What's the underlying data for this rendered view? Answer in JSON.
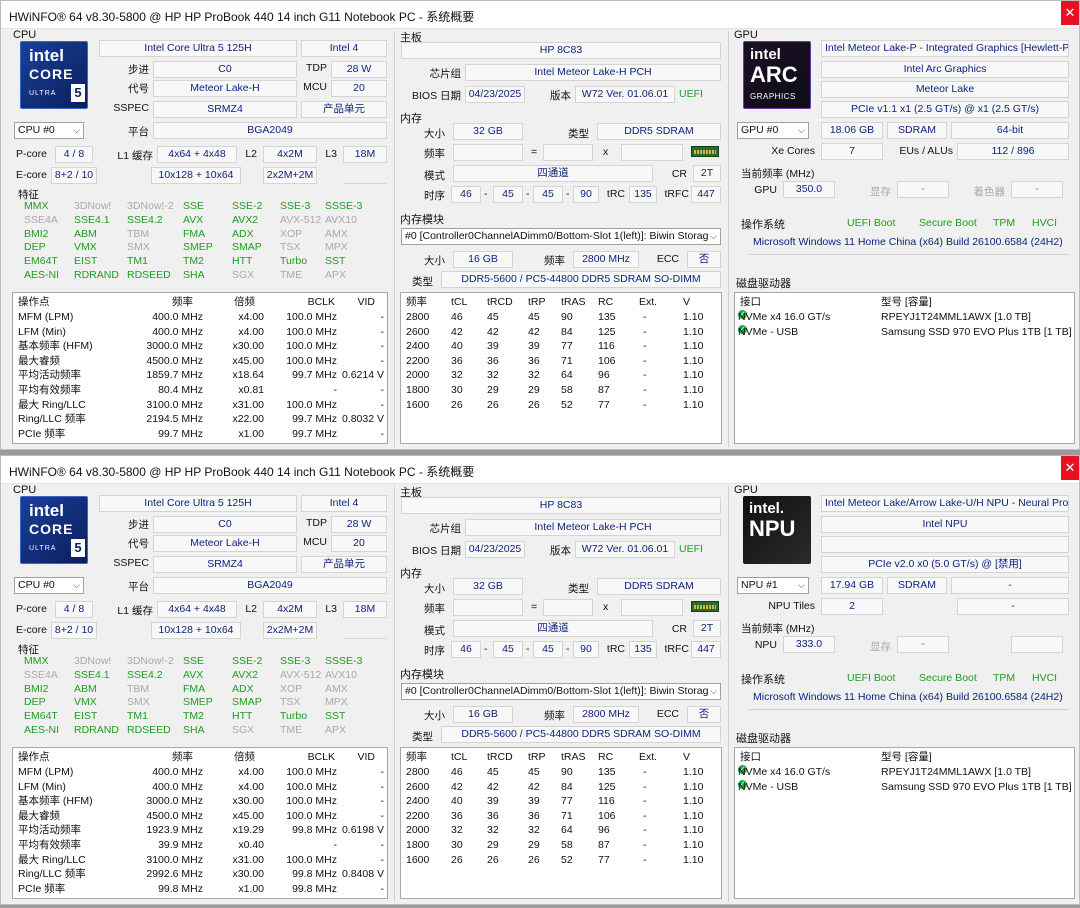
{
  "windows": [
    {
      "title": "HWiNFO® 64 v8.30-5800 @ HP HP ProBook 440 14 inch G11 Notebook PC - 系统概要",
      "close_icon": "✕",
      "cpu": {
        "section": "CPU",
        "name": "Intel Core Ultra 5 125H",
        "gen": "Intel 4",
        "stepping_label": "步进",
        "stepping": "C0",
        "tdp_label": "TDP",
        "tdp": "28 W",
        "codename_label": "代号",
        "codename": "Meteor Lake-H",
        "mcu_label": "MCU",
        "mcu": "20",
        "sspec_label": "SSPEC",
        "sspec": "SRMZ4",
        "produnit": "产品单元",
        "selector": "CPU #0",
        "platform_label": "平台",
        "platform": "BGA2049",
        "pcore_label": "P-core",
        "pcore": "4 / 8",
        "l1_label": "L1 缓存",
        "l1": "4x64 + 4x48",
        "l2_label": "L2",
        "l2": "4x2M",
        "l3_label": "L3",
        "l3": "18M",
        "ecore_label": "E-core",
        "ecore": "8+2 / 10",
        "l1e": "10x128 + 10x64",
        "l2e": "2x2M+2M",
        "features_label": "特征",
        "features": [
          [
            "MMX",
            "3DNow!",
            "3DNow!-2",
            "SSE",
            "SSE-2",
            "SSE-3",
            "SSSE-3"
          ],
          [
            "SSE4A",
            "SSE4.1",
            "SSE4.2",
            "AVX",
            "AVX2",
            "AVX-512",
            "AVX10"
          ],
          [
            "BMI2",
            "ABM",
            "TBM",
            "FMA",
            "ADX",
            "XOP",
            "AMX"
          ],
          [
            "DEP",
            "VMX",
            "SMX",
            "SMEP",
            "SMAP",
            "TSX",
            "MPX"
          ],
          [
            "EM64T",
            "EIST",
            "TM1",
            "TM2",
            "HTT",
            "Turbo",
            "SST"
          ],
          [
            "AES-NI",
            "RDRAND",
            "RDSEED",
            "SHA",
            "SGX",
            "TME",
            "APX"
          ]
        ],
        "features_enabled": [
          [
            1,
            0,
            0,
            1,
            1,
            1,
            1
          ],
          [
            0,
            1,
            1,
            1,
            1,
            0,
            0
          ],
          [
            1,
            1,
            0,
            1,
            1,
            0,
            0
          ],
          [
            1,
            1,
            0,
            1,
            1,
            0,
            0
          ],
          [
            1,
            1,
            1,
            1,
            1,
            1,
            1
          ],
          [
            1,
            1,
            1,
            1,
            0,
            0,
            0
          ]
        ],
        "op_headers": [
          "操作点",
          "频率",
          "倍频",
          "BCLK",
          "VID"
        ],
        "op_rows": [
          [
            "MFM (LPM)",
            "400.0 MHz",
            "x4.00",
            "100.0 MHz",
            "-"
          ],
          [
            "LFM (Min)",
            "400.0 MHz",
            "x4.00",
            "100.0 MHz",
            "-"
          ],
          [
            "基本频率 (HFM)",
            "3000.0 MHz",
            "x30.00",
            "100.0 MHz",
            "-"
          ],
          [
            "最大睿频",
            "4500.0 MHz",
            "x45.00",
            "100.0 MHz",
            "-"
          ],
          [
            "平均活动频率",
            "1859.7 MHz",
            "x18.64",
            "99.7 MHz",
            "0.6214 V"
          ],
          [
            "平均有效频率",
            "80.4 MHz",
            "x0.81",
            "-",
            "-"
          ],
          [
            "最大 Ring/LLC",
            "3100.0 MHz",
            "x31.00",
            "100.0 MHz",
            "-"
          ],
          [
            "Ring/LLC 频率",
            "2194.5 MHz",
            "x22.00",
            "99.7 MHz",
            "0.8032 V"
          ],
          [
            "PCIe 频率",
            "99.7 MHz",
            "x1.00",
            "99.7 MHz",
            "-"
          ]
        ]
      },
      "mb": {
        "section": "主板",
        "name": "HP 8C83",
        "chipset_label": "芯片组",
        "chipset": "Intel Meteor Lake-H PCH",
        "bios_label": "BIOS 日期",
        "bios_date": "04/23/2025",
        "ver_label": "版本",
        "bios_ver": "W72 Ver. 01.06.01",
        "uefi": "UEFI"
      },
      "mem": {
        "section": "内存",
        "size_label": "大小",
        "size": "32 GB",
        "type_label": "类型",
        "type": "DDR5 SDRAM",
        "freq_label": "频率",
        "eq": "=",
        "x": "x",
        "mode_label": "模式",
        "mode": "四通道",
        "cr_label": "CR",
        "cr": "2T",
        "timing_label": "时序",
        "t1": "46",
        "t2": "45",
        "t3": "45",
        "t4": "90",
        "dash": "-",
        "trc_label": "tRC",
        "trc": "135",
        "trfc_label": "tRFC",
        "trfc": "447"
      },
      "modules": {
        "section": "内存模块",
        "selector": "#0 [Controller0ChannelADimm0/Bottom-Slot 1(left)]: Biwin Storag",
        "size_label": "大小",
        "size": "16 GB",
        "freq_label": "频率",
        "freq": "2800 MHz",
        "ecc_label": "ECC",
        "ecc": "否",
        "type_label": "类型",
        "type": "DDR5-5600 / PC5-44800 DDR5 SDRAM SO-DIMM",
        "headers": [
          "频率",
          "tCL",
          "tRCD",
          "tRP",
          "tRAS",
          "RC",
          "Ext.",
          "V"
        ],
        "rows": [
          [
            "2800",
            "46",
            "45",
            "45",
            "90",
            "135",
            "-",
            "1.10"
          ],
          [
            "2600",
            "42",
            "42",
            "42",
            "84",
            "125",
            "-",
            "1.10"
          ],
          [
            "2400",
            "40",
            "39",
            "39",
            "77",
            "116",
            "-",
            "1.10"
          ],
          [
            "2200",
            "36",
            "36",
            "36",
            "71",
            "106",
            "-",
            "1.10"
          ],
          [
            "2000",
            "32",
            "32",
            "32",
            "64",
            "96",
            "-",
            "1.10"
          ],
          [
            "1800",
            "30",
            "29",
            "29",
            "58",
            "87",
            "-",
            "1.10"
          ],
          [
            "1600",
            "26",
            "26",
            "26",
            "52",
            "77",
            "-",
            "1.10"
          ]
        ]
      },
      "gpu": {
        "section": "GPU",
        "logo_top": "intel",
        "logo_mid": "ARC",
        "logo_bot": "GRAPHICS",
        "name": "Intel Meteor Lake-P - Integrated Graphics [Hewlett-Pac",
        "name2": "Intel Arc Graphics",
        "name3": "Meteor Lake",
        "pcie": "PCIe v1.1 x1 (2.5 GT/s) @ x1 (2.5 GT/s)",
        "selector": "GPU #0",
        "vram": "18.06 GB",
        "vtype": "SDRAM",
        "bus": "64-bit",
        "cores_label": "Xe Cores",
        "cores": "7",
        "eus_label": "EUs / ALUs",
        "eus": "112 / 896",
        "clock_label": "当前频率 (MHz)",
        "clk_name": "GPU",
        "clk": "350.0",
        "mem_label": "显存",
        "mem": "-",
        "shader_label": "着色器",
        "shader": "-"
      },
      "os": {
        "section": "操作系统",
        "uefi": "UEFI Boot",
        "secure": "Secure Boot",
        "tpm": "TPM",
        "hvci": "HVCI",
        "name": "Microsoft Windows 11 Home China (x64) Build 26100.6584 (24H2)"
      },
      "disk": {
        "section": "磁盘驱动器",
        "h1": "接口",
        "h2": "型号 [容量]",
        "rows": [
          [
            "NVMe x4 16.0 GT/s",
            "RPEYJ1T24MML1AWX [1.0 TB]"
          ],
          [
            "NVMe - USB",
            "Samsung SSD 970 EVO Plus 1TB [1 TB]"
          ]
        ]
      }
    },
    {
      "title": "HWiNFO® 64 v8.30-5800 @ HP HP ProBook 440 14 inch G11 Notebook PC - 系统概要",
      "close_icon": "✕",
      "cpu": {
        "section": "CPU",
        "name": "Intel Core Ultra 5 125H",
        "gen": "Intel 4",
        "stepping_label": "步进",
        "stepping": "C0",
        "tdp_label": "TDP",
        "tdp": "28 W",
        "codename_label": "代号",
        "codename": "Meteor Lake-H",
        "mcu_label": "MCU",
        "mcu": "20",
        "sspec_label": "SSPEC",
        "sspec": "SRMZ4",
        "produnit": "产品单元",
        "selector": "CPU #0",
        "platform_label": "平台",
        "platform": "BGA2049",
        "pcore_label": "P-core",
        "pcore": "4 / 8",
        "l1_label": "L1 缓存",
        "l1": "4x64 + 4x48",
        "l2_label": "L2",
        "l2": "4x2M",
        "l3_label": "L3",
        "l3": "18M",
        "ecore_label": "E-core",
        "ecore": "8+2 / 10",
        "l1e": "10x128 + 10x64",
        "l2e": "2x2M+2M",
        "features_label": "特征",
        "features": [
          [
            "MMX",
            "3DNow!",
            "3DNow!-2",
            "SSE",
            "SSE-2",
            "SSE-3",
            "SSSE-3"
          ],
          [
            "SSE4A",
            "SSE4.1",
            "SSE4.2",
            "AVX",
            "AVX2",
            "AVX-512",
            "AVX10"
          ],
          [
            "BMI2",
            "ABM",
            "TBM",
            "FMA",
            "ADX",
            "XOP",
            "AMX"
          ],
          [
            "DEP",
            "VMX",
            "SMX",
            "SMEP",
            "SMAP",
            "TSX",
            "MPX"
          ],
          [
            "EM64T",
            "EIST",
            "TM1",
            "TM2",
            "HTT",
            "Turbo",
            "SST"
          ],
          [
            "AES-NI",
            "RDRAND",
            "RDSEED",
            "SHA",
            "SGX",
            "TME",
            "APX"
          ]
        ],
        "features_enabled": [
          [
            1,
            0,
            0,
            1,
            1,
            1,
            1
          ],
          [
            0,
            1,
            1,
            1,
            1,
            0,
            0
          ],
          [
            1,
            1,
            0,
            1,
            1,
            0,
            0
          ],
          [
            1,
            1,
            0,
            1,
            1,
            0,
            0
          ],
          [
            1,
            1,
            1,
            1,
            1,
            1,
            1
          ],
          [
            1,
            1,
            1,
            1,
            0,
            0,
            0
          ]
        ],
        "op_headers": [
          "操作点",
          "频率",
          "倍频",
          "BCLK",
          "VID"
        ],
        "op_rows": [
          [
            "MFM (LPM)",
            "400.0 MHz",
            "x4.00",
            "100.0 MHz",
            "-"
          ],
          [
            "LFM (Min)",
            "400.0 MHz",
            "x4.00",
            "100.0 MHz",
            "-"
          ],
          [
            "基本频率 (HFM)",
            "3000.0 MHz",
            "x30.00",
            "100.0 MHz",
            "-"
          ],
          [
            "最大睿频",
            "4500.0 MHz",
            "x45.00",
            "100.0 MHz",
            "-"
          ],
          [
            "平均活动频率",
            "1923.9 MHz",
            "x19.29",
            "99.8 MHz",
            "0.6198 V"
          ],
          [
            "平均有效频率",
            "39.9 MHz",
            "x0.40",
            "-",
            "-"
          ],
          [
            "最大 Ring/LLC",
            "3100.0 MHz",
            "x31.00",
            "100.0 MHz",
            "-"
          ],
          [
            "Ring/LLC 频率",
            "2992.6 MHz",
            "x30.00",
            "99.8 MHz",
            "0.8408 V"
          ],
          [
            "PCIe 频率",
            "99.8 MHz",
            "x1.00",
            "99.8 MHz",
            "-"
          ]
        ]
      },
      "mb": {
        "section": "主板",
        "name": "HP 8C83",
        "chipset_label": "芯片组",
        "chipset": "Intel Meteor Lake-H PCH",
        "bios_label": "BIOS 日期",
        "bios_date": "04/23/2025",
        "ver_label": "版本",
        "bios_ver": "W72 Ver. 01.06.01",
        "uefi": "UEFI"
      },
      "mem": {
        "section": "内存",
        "size_label": "大小",
        "size": "32 GB",
        "type_label": "类型",
        "type": "DDR5 SDRAM",
        "freq_label": "频率",
        "eq": "=",
        "x": "x",
        "mode_label": "模式",
        "mode": "四通道",
        "cr_label": "CR",
        "cr": "2T",
        "timing_label": "时序",
        "t1": "46",
        "t2": "45",
        "t3": "45",
        "t4": "90",
        "dash": "-",
        "trc_label": "tRC",
        "trc": "135",
        "trfc_label": "tRFC",
        "trfc": "447"
      },
      "modules": {
        "section": "内存模块",
        "selector": "#0 [Controller0ChannelADimm0/Bottom-Slot 1(left)]: Biwin Storag",
        "size_label": "大小",
        "size": "16 GB",
        "freq_label": "频率",
        "freq": "2800 MHz",
        "ecc_label": "ECC",
        "ecc": "否",
        "type_label": "类型",
        "type": "DDR5-5600 / PC5-44800 DDR5 SDRAM SO-DIMM",
        "headers": [
          "频率",
          "tCL",
          "tRCD",
          "tRP",
          "tRAS",
          "RC",
          "Ext.",
          "V"
        ],
        "rows": [
          [
            "2800",
            "46",
            "45",
            "45",
            "90",
            "135",
            "-",
            "1.10"
          ],
          [
            "2600",
            "42",
            "42",
            "42",
            "84",
            "125",
            "-",
            "1.10"
          ],
          [
            "2400",
            "40",
            "39",
            "39",
            "77",
            "116",
            "-",
            "1.10"
          ],
          [
            "2200",
            "36",
            "36",
            "36",
            "71",
            "106",
            "-",
            "1.10"
          ],
          [
            "2000",
            "32",
            "32",
            "32",
            "64",
            "96",
            "-",
            "1.10"
          ],
          [
            "1800",
            "30",
            "29",
            "29",
            "58",
            "87",
            "-",
            "1.10"
          ],
          [
            "1600",
            "26",
            "26",
            "26",
            "52",
            "77",
            "-",
            "1.10"
          ]
        ]
      },
      "gpu": {
        "section": "GPU",
        "logo_top": "intel.",
        "logo_mid": "NPU",
        "logo_bot": "",
        "name": "Intel Meteor Lake/Arrow Lake-U/H NPU - Neural Proces",
        "name2": "Intel NPU",
        "name3": "",
        "pcie": "PCIe v2.0 x0 (5.0 GT/s) @ [禁用]",
        "selector": "NPU #1",
        "vram": "17.94 GB",
        "vtype": "SDRAM",
        "bus": "-",
        "cores_label": "NPU Tiles",
        "cores": "2",
        "eus_label": "",
        "eus": "-",
        "clock_label": "当前频率 (MHz)",
        "clk_name": "NPU",
        "clk": "333.0",
        "mem_label": "显存",
        "mem": "-",
        "shader_label": "",
        "shader": ""
      },
      "os": {
        "section": "操作系统",
        "uefi": "UEFI Boot",
        "secure": "Secure Boot",
        "tpm": "TPM",
        "hvci": "HVCI",
        "name": "Microsoft Windows 11 Home China (x64) Build 26100.6584 (24H2)"
      },
      "disk": {
        "section": "磁盘驱动器",
        "h1": "接口",
        "h2": "型号 [容量]",
        "rows": [
          [
            "NVMe x4 16.0 GT/s",
            "RPEYJ1T24MML1AWX [1.0 TB]"
          ],
          [
            "NVMe - USB",
            "Samsung SSD 970 EVO Plus 1TB [1 TB]"
          ]
        ]
      }
    }
  ],
  "colors": {
    "value_text": "#0b1f7a",
    "feature_on": "#1f9c1f",
    "feature_off": "#a9a9a9",
    "close_bg": "#e81123",
    "check": "#1fa84a"
  }
}
